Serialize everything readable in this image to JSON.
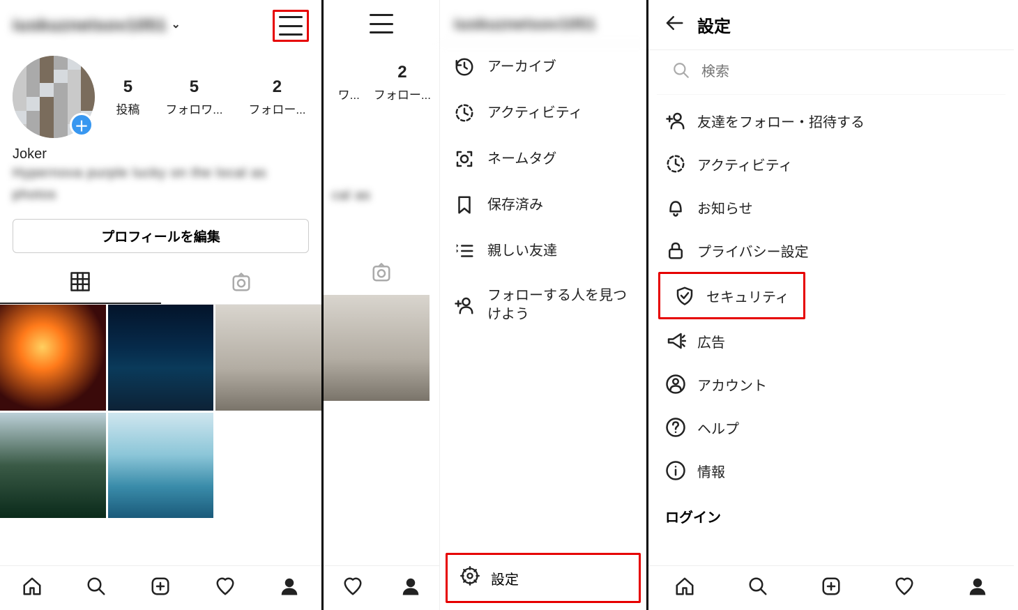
{
  "panel1": {
    "username": "iuskuznetsov1051",
    "stats": {
      "posts_num": "5",
      "posts_label": "投稿",
      "followers_num": "5",
      "followers_label": "フォロワ...",
      "following_num": "2",
      "following_label": "フォロー..."
    },
    "display_name": "Joker",
    "bio_text_1": "Hypernova purple lucky on the local as",
    "bio_text_2": "photos",
    "edit_profile_label": "プロフィールを編集"
  },
  "panel2": {
    "username": "iuskuznetsov1051",
    "visible_stats": {
      "followers_short": "ワ...",
      "following_num": "2",
      "following_label": "フォロー..."
    },
    "bio_fragment": "cal as",
    "drawer": {
      "items": [
        {
          "label": "アーカイブ"
        },
        {
          "label": "アクティビティ"
        },
        {
          "label": "ネームタグ"
        },
        {
          "label": "保存済み"
        },
        {
          "label": "親しい友達"
        },
        {
          "label": "フォローする人を見つけよう"
        }
      ],
      "settings_label": "設定"
    }
  },
  "panel3": {
    "title": "設定",
    "search_placeholder": "検索",
    "items": [
      {
        "label": "友達をフォロー・招待する"
      },
      {
        "label": "アクティビティ"
      },
      {
        "label": "お知らせ"
      },
      {
        "label": "プライバシー設定"
      },
      {
        "label": "セキュリティ"
      },
      {
        "label": "広告"
      },
      {
        "label": "アカウント"
      },
      {
        "label": "ヘルプ"
      },
      {
        "label": "情報"
      }
    ],
    "login_section_label": "ログイン"
  }
}
